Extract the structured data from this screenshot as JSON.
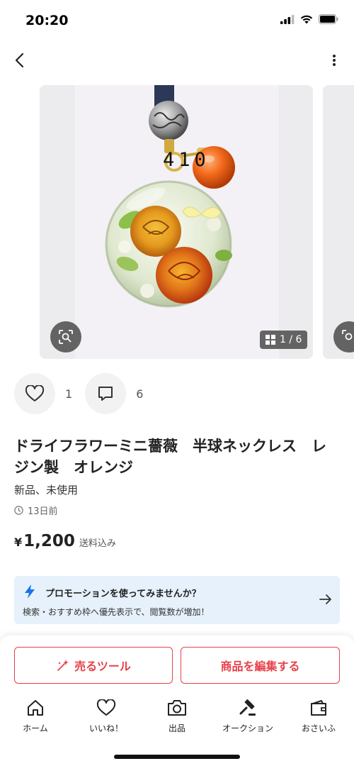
{
  "status_bar": {
    "time": "20:20"
  },
  "header": {
    "back_icon": "chevron-left-icon",
    "menu_icon": "more-vertical-icon"
  },
  "gallery": {
    "image_label": "410",
    "counter": "1 / 6",
    "grid_icon": "grid-icon",
    "lens_icon": "image-search-icon"
  },
  "actions": {
    "like_icon": "heart-icon",
    "like_count": "1",
    "comment_icon": "comment-icon",
    "comment_count": "6"
  },
  "item": {
    "title": "ドライフラワーミニ薔薇　半球ネックレス　レジン製　オレンジ",
    "condition": "新品、未使用",
    "posted": "13日前",
    "currency": "¥",
    "price": "1,200",
    "shipping": "送料込み"
  },
  "promo": {
    "icon": "lightning-icon",
    "title": "プロモーションを使ってみませんか？",
    "text": "検索・おすすめ枠へ優先表示で、閲覧数が増加！"
  },
  "buttons": {
    "sell_tools": "売るツール",
    "edit_item": "商品を編集する"
  },
  "tabs": [
    {
      "label": "ホーム",
      "icon": "home-icon"
    },
    {
      "label": "いいね！",
      "icon": "heart-icon"
    },
    {
      "label": "出品",
      "icon": "camera-icon"
    },
    {
      "label": "オークション",
      "icon": "gavel-icon"
    },
    {
      "label": "おさいふ",
      "icon": "wallet-icon"
    }
  ],
  "colors": {
    "accent": "#e8414b",
    "promo_bg": "#e6f1fb",
    "promo_icon": "#1a73e8"
  }
}
